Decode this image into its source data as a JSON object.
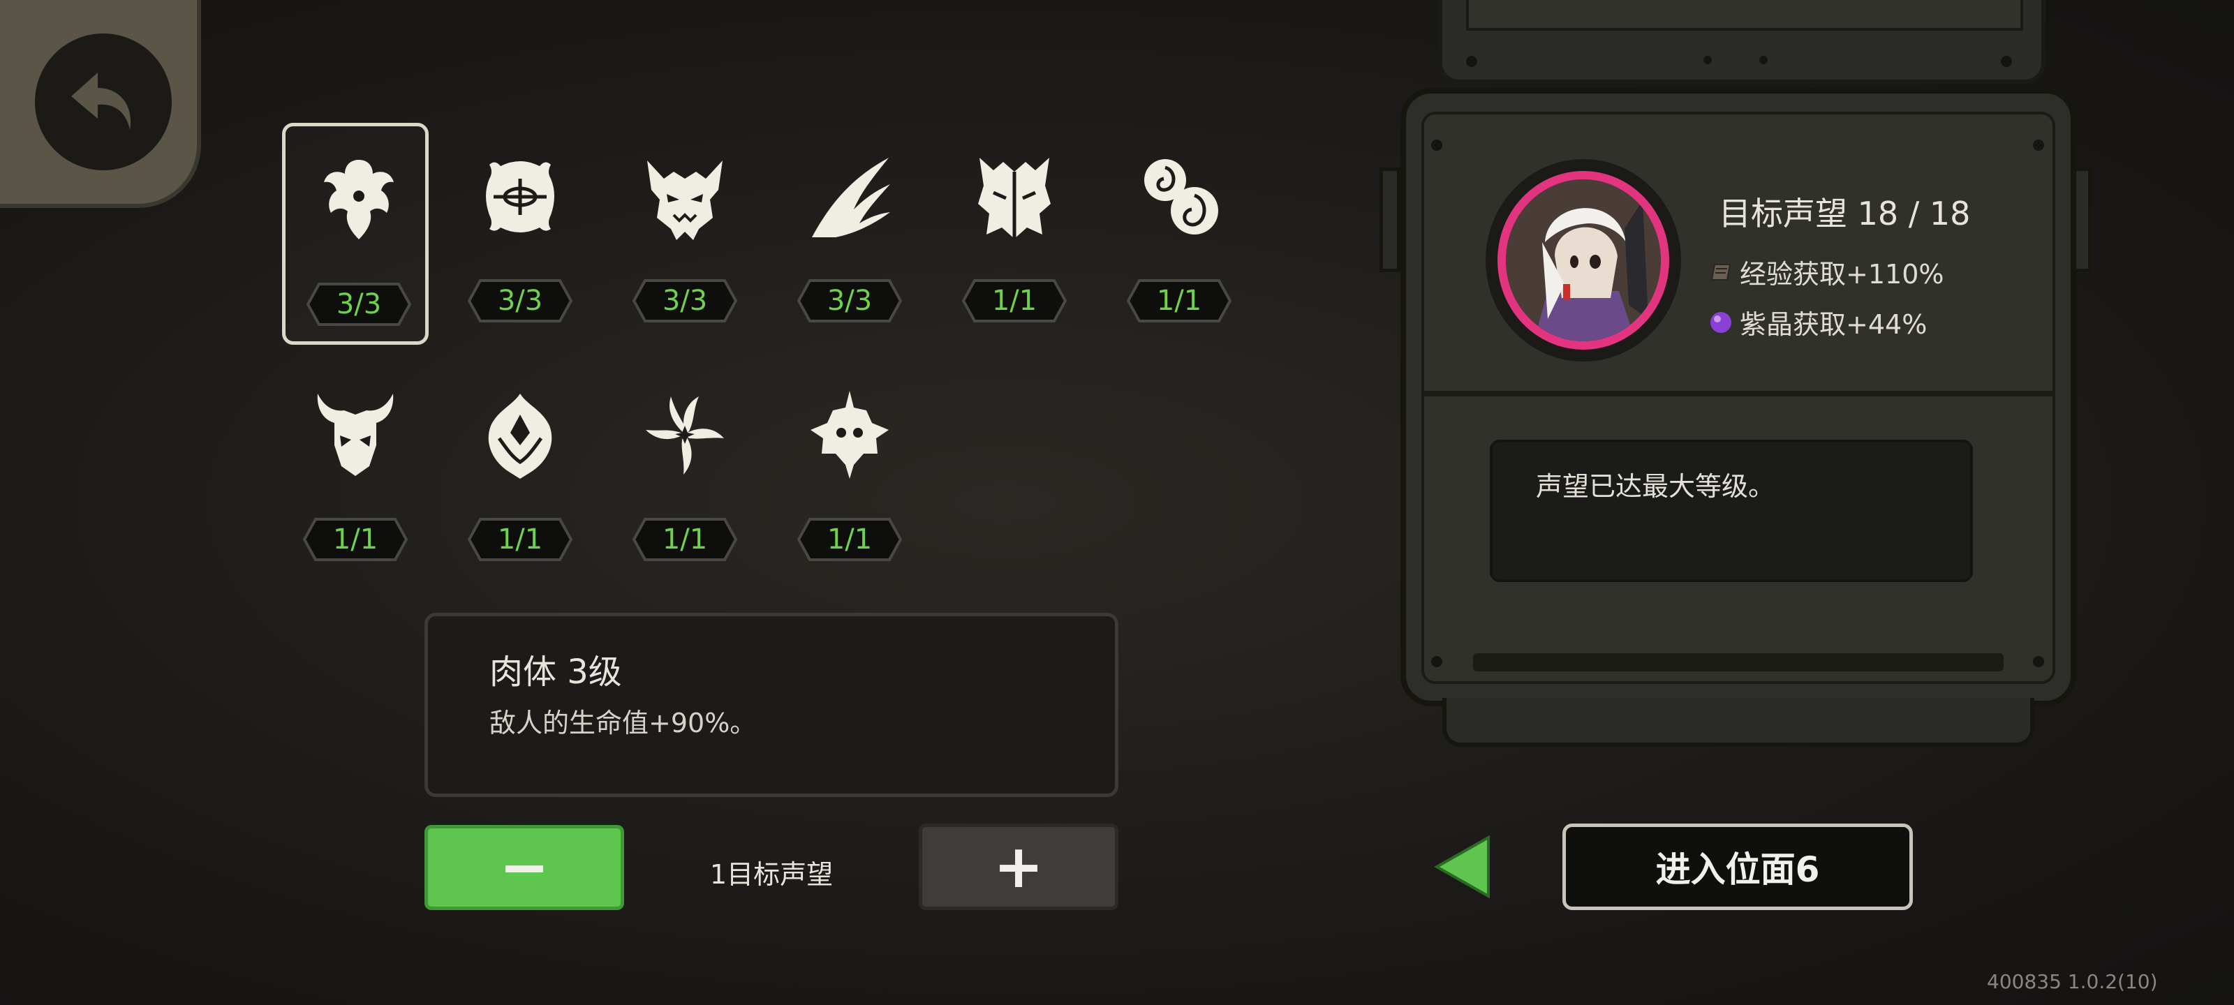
{
  "back": {
    "icon": "back-arrow-icon"
  },
  "curses": [
    {
      "icon": "flesh-curse-icon",
      "count": "3/3",
      "selected": true
    },
    {
      "icon": "bound-eye-curse-icon",
      "count": "3/3"
    },
    {
      "icon": "demon-mask-curse-icon",
      "count": "3/3"
    },
    {
      "icon": "claw-swipe-curse-icon",
      "count": "3/3"
    },
    {
      "icon": "twin-face-curse-icon",
      "count": "1/1"
    },
    {
      "icon": "swirl-orb-curse-icon",
      "count": "1/1"
    },
    {
      "icon": "horned-skull-curse-icon",
      "count": "1/1"
    },
    {
      "icon": "spirit-flame-curse-icon",
      "count": "1/1"
    },
    {
      "icon": "spiral-star-curse-icon",
      "count": "1/1"
    },
    {
      "icon": "crowned-spike-curse-icon",
      "count": "1/1"
    }
  ],
  "detail": {
    "title": "肉体 3级",
    "text": "敌人的生命值+90%。"
  },
  "controls": {
    "minus_label": "−",
    "plus_label": "+",
    "step_label": "1目标声望"
  },
  "reputation": {
    "title": "目标声望 18 / 18",
    "exp_bonus": "经验获取+110%",
    "crystal_bonus": "紫晶获取+44%",
    "message": "声望已达最大等级。"
  },
  "enter_button": "进入位面6",
  "version": "400835 1.0.2(10)",
  "colors": {
    "count_green": "#6fd24c",
    "minus_green": "#5ec64f",
    "portrait_ring": "#e3357f",
    "crystal_purple": "#8a3fd6"
  }
}
